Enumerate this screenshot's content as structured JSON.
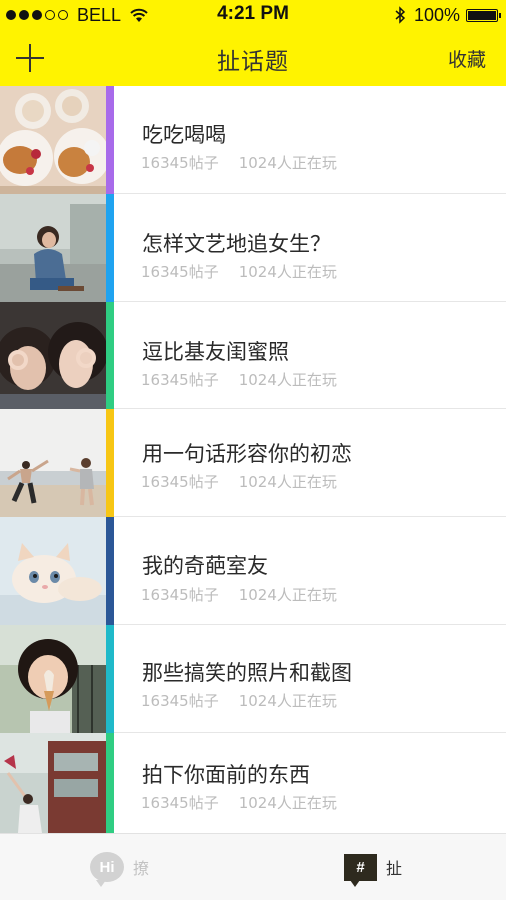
{
  "status_bar": {
    "carrier": "BELL",
    "time": "4:21 PM",
    "battery_text": "100%",
    "signal_bars_filled": 3,
    "signal_bars_total": 5
  },
  "nav": {
    "add_icon": "plus-icon",
    "title": "扯话题",
    "right_label": "收藏"
  },
  "colors": {
    "brand_yellow": "#FFF300",
    "stripes": [
      "#A86BEA",
      "#1FA3F0",
      "#2FCD82",
      "#F7C614",
      "#2B5797",
      "#1FB9C9",
      "#2FCD82"
    ]
  },
  "topics": [
    {
      "title": "吃吃喝喝",
      "posts": "16345帖子",
      "players": "1024人正在玩",
      "thumb": "food-photo"
    },
    {
      "title": "怎样文艺地追女生？",
      "posts": "16345帖子",
      "players": "1024人正在玩",
      "thumb": "girl-sitting-photo"
    },
    {
      "title": "逗比基友闺蜜照",
      "posts": "16345帖子",
      "players": "1024人正在玩",
      "thumb": "friends-photo"
    },
    {
      "title": "用一句话形容你的初恋",
      "posts": "16345帖子",
      "players": "1024人正在玩",
      "thumb": "beach-photo"
    },
    {
      "title": "我的奇葩室友",
      "posts": "16345帖子",
      "players": "1024人正在玩",
      "thumb": "cat-photo"
    },
    {
      "title": "那些搞笑的照片和截图",
      "posts": "16345帖子",
      "players": "1024人正在玩",
      "thumb": "icecream-photo"
    },
    {
      "title": "拍下你面前的东西",
      "posts": "16345帖子",
      "players": "1024人正在玩",
      "thumb": "train-photo"
    }
  ],
  "tabbar": {
    "tabs": [
      {
        "icon_text": "Hi",
        "label": "撩",
        "icon": "hi-chat-icon",
        "active": false
      },
      {
        "icon_text": "#",
        "label": "扯",
        "icon": "hash-chat-icon",
        "active": true
      }
    ]
  }
}
